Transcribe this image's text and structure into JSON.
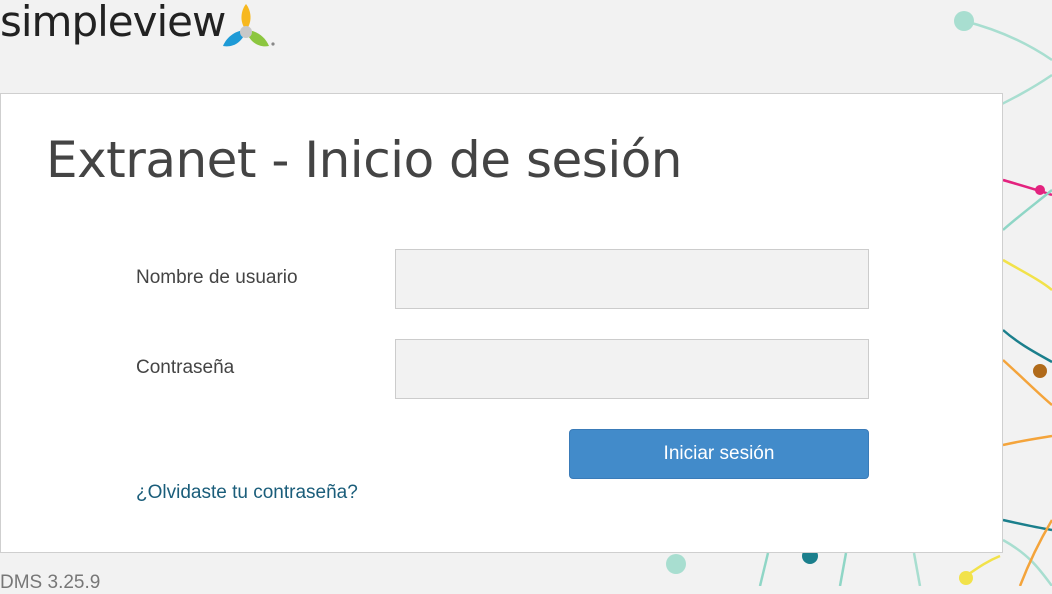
{
  "brand": {
    "name": "simpleview",
    "logo_icon": "tri-leaf-icon",
    "colors": {
      "yellow": "#f7b81e",
      "blue": "#1e9ad6",
      "green": "#8cc63f",
      "gray": "#c8c8c8"
    }
  },
  "page": {
    "title": "Extranet - Inicio de sesión"
  },
  "form": {
    "username_label": "Nombre de usuario",
    "username_value": "",
    "password_label": "Contraseña",
    "password_value": "",
    "submit_label": "Iniciar sesión",
    "forgot_label": "¿Olvidaste tu contraseña?"
  },
  "footer": {
    "version": "DMS 3.25.9"
  },
  "colors": {
    "button": "#428bca",
    "link": "#1a5d7a",
    "input_bg": "#f2f2f2"
  }
}
